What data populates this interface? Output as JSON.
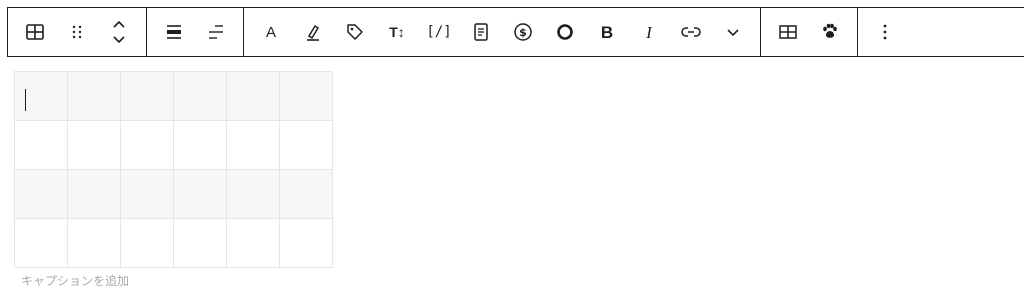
{
  "toolbar": {
    "groups": [
      [
        "table-icon",
        "drag-handle-icon",
        "move-up-down-icon"
      ],
      [
        "align-center-icon",
        "align-right-icon"
      ],
      [
        "text-A",
        "highlighter-icon",
        "tag-icon",
        "text-size-icon",
        "code-icon",
        "document-icon",
        "dollar-icon",
        "circle-icon",
        "bold",
        "italic",
        "link-icon",
        "chevron-down-icon"
      ],
      [
        "table-edit-icon",
        "paw-icon"
      ],
      [
        "more-options-icon"
      ]
    ],
    "labels": {
      "text_a": "A",
      "text_size": "T↕",
      "code": "[/]",
      "bold": "B",
      "italic": "I"
    }
  },
  "table": {
    "rows": 4,
    "columns": 6
  },
  "caption": {
    "placeholder": "キャプションを追加"
  }
}
